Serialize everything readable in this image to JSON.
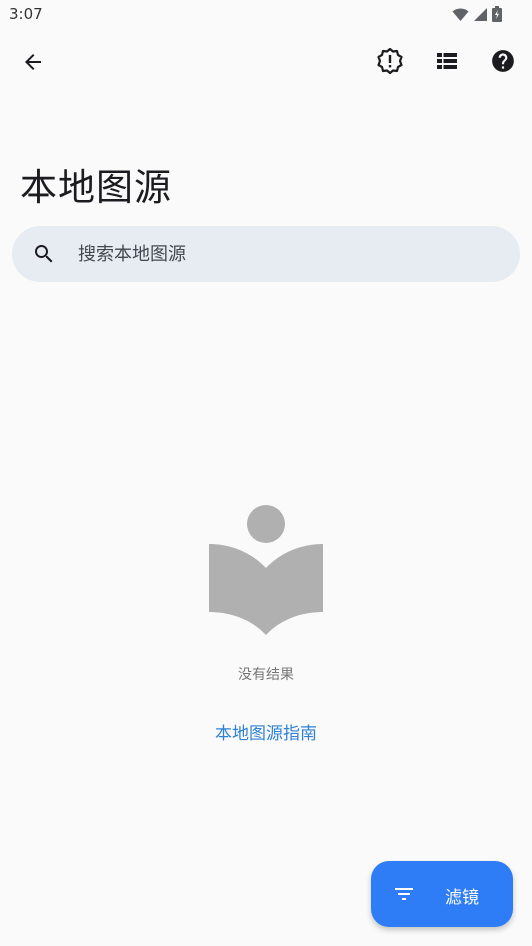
{
  "status_bar": {
    "time": "3:07",
    "icons": [
      "wifi-icon",
      "signal-icon",
      "battery-icon"
    ]
  },
  "app_bar": {
    "back_icon": "arrow-back-icon",
    "actions": [
      {
        "name": "alert-badge-icon"
      },
      {
        "name": "list-view-icon"
      },
      {
        "name": "help-icon"
      }
    ]
  },
  "page": {
    "title": "本地图源"
  },
  "search": {
    "placeholder": "搜索本地图源",
    "value": ""
  },
  "empty_state": {
    "illustration": "reader-book-icon",
    "message": "没有结果",
    "guide_link": "本地图源指南"
  },
  "fab": {
    "icon": "filter-icon",
    "label": "滤镜"
  },
  "colors": {
    "background": "#fafafa",
    "search_bg": "#e7ecf3",
    "accent": "#2f7df6",
    "link": "#2f80d6",
    "illustration": "#b0b0b0"
  }
}
